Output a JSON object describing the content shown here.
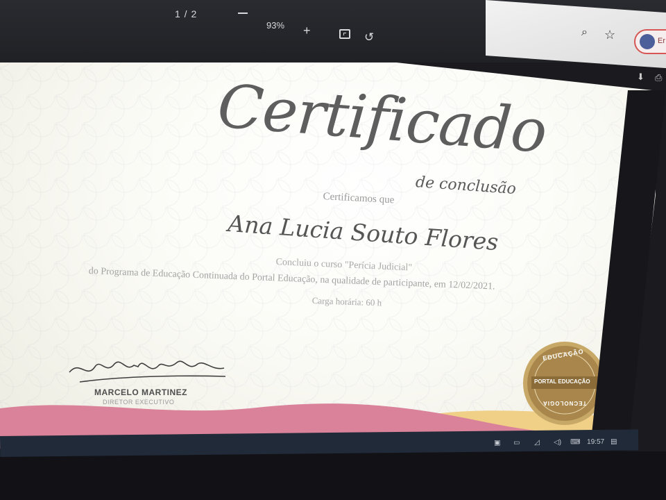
{
  "viewer": {
    "page_indicator": "1 / 2",
    "zoom_out": "−",
    "zoom": "93%",
    "zoom_in": "+",
    "rotate_icon": "↺"
  },
  "browser": {
    "search_icon": "⌕",
    "star_icon": "☆",
    "profile_text": "Er",
    "download_icon": "⬇",
    "print_icon": "⎙"
  },
  "certificate": {
    "title": "Certificado",
    "subtitle": "de conclusão",
    "certify_line": "Certificamos que",
    "recipient": "Ana Lucia Souto Flores",
    "course_line": "Concluiu o curso \"Perícia Judicial\"",
    "program_line": "do Programa de Educação Continuada do Portal Educação, na qualidade de participante, em 12/02/2021.",
    "hours_line": "Carga horária: 60 h",
    "signer_name": "MARCELO MARTINEZ",
    "signer_role": "DIRETOR EXECUTIVO",
    "seal": {
      "top": "EDUCAÇÃO",
      "middle": "PORTAL EDUCAÇÃO",
      "bottom": "TECNOLOGIA"
    },
    "colors": {
      "wave_pink": "#d98299",
      "wave_yellow": "#f0cf86",
      "seal_gold": "#b9955a"
    }
  },
  "taskbar": {
    "time": "19:57"
  }
}
